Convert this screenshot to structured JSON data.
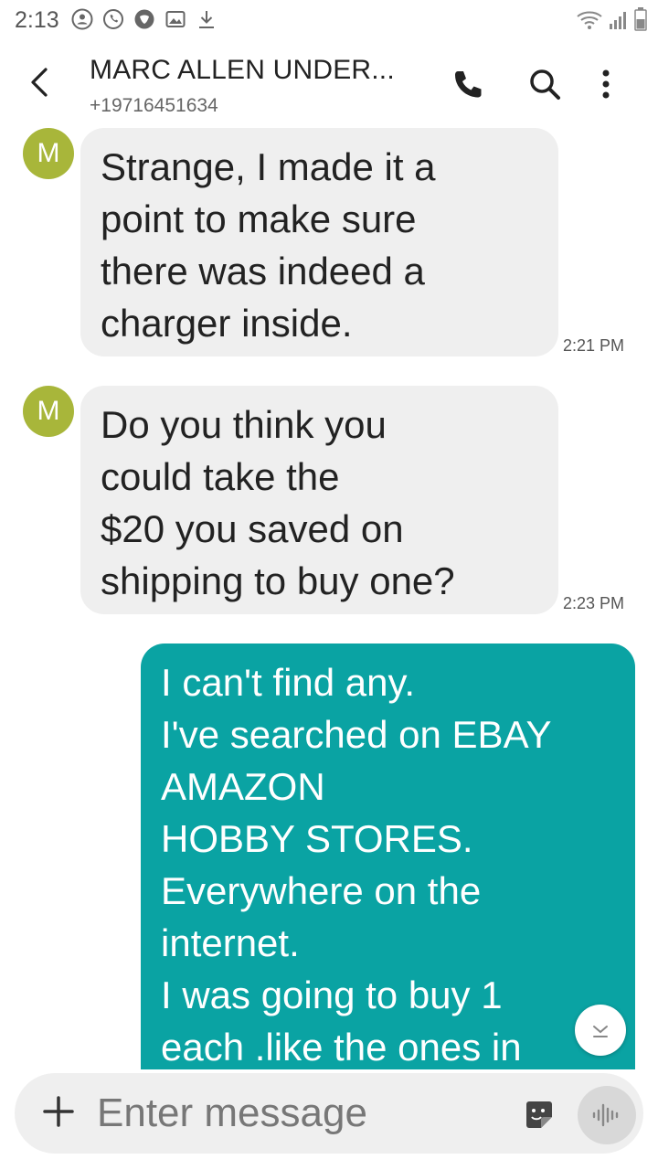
{
  "status_bar": {
    "time": "2:13",
    "icons_left": [
      "contact-icon",
      "whatsapp-icon",
      "shield-icon",
      "gallery-icon",
      "download-icon"
    ],
    "icons_right": [
      "wifi-icon",
      "signal-icon",
      "battery-icon"
    ]
  },
  "header": {
    "contact_name": "MARC ALLEN UNDER...",
    "contact_number": "+19716451634",
    "actions": [
      "back-icon",
      "phone-icon",
      "search-icon",
      "more-vertical-icon"
    ]
  },
  "messages": [
    {
      "direction": "incoming",
      "avatar_letter": "M",
      "lines": [
        "Strange, I made it a",
        "point to make sure",
        "there was indeed a",
        "charger inside."
      ],
      "time": "2:21 PM"
    },
    {
      "direction": "incoming",
      "avatar_letter": "M",
      "lines": [
        "Do you think you",
        "could take the",
        "$20 you saved on",
        "shipping to buy one?"
      ],
      "time": "2:23 PM"
    },
    {
      "direction": "outgoing",
      "lines": [
        "I can't find any.",
        "I've searched on EBAY",
        "AMAZON",
        "HOBBY STORES.",
        "Everywhere on the",
        "internet.",
        "I was going to buy 1",
        "each .like the ones in"
      ]
    }
  ],
  "composer": {
    "placeholder": "Enter message",
    "icons": [
      "plus-icon",
      "sticker-icon",
      "voice-icon"
    ]
  },
  "colors": {
    "incoming_bubble": "#efefef",
    "outgoing_bubble": "#0aa3a3",
    "avatar": "#a8b63a"
  }
}
